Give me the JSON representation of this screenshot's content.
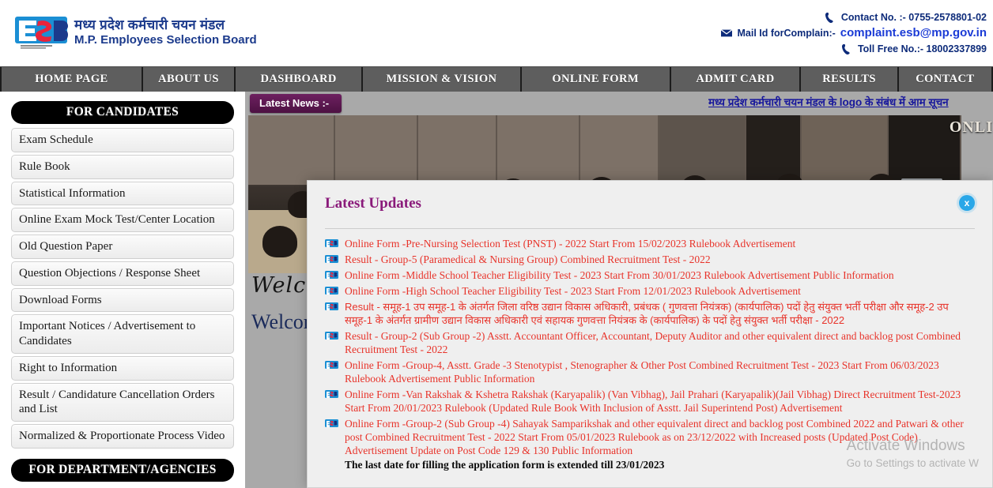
{
  "header": {
    "logo": {
      "abbr": "ESB",
      "hindi_title": "मध्य प्रदेश कर्मचारी चयन मंडल",
      "english_title": "M.P. Employees Selection Board"
    },
    "contact": {
      "phone_icon": "phone-icon",
      "phone_label": "Contact No. :- 0755-2578801-02",
      "mail_icon": "mail-icon",
      "mail_label": "Mail Id forComplain:-",
      "mail_value": "complaint.esb@mp.gov.in",
      "tollfree_icon": "phone-icon",
      "tollfree_label": "Toll Free No.:- 18002337899"
    }
  },
  "nav": {
    "items": [
      {
        "label": "HOME PAGE"
      },
      {
        "label": "ABOUT US"
      },
      {
        "label": "DASHBOARD"
      },
      {
        "label": "MISSION & VISION"
      },
      {
        "label": "ONLINE FORM"
      },
      {
        "label": "ADMIT CARD"
      },
      {
        "label": "RESULTS"
      },
      {
        "label": "CONTACT"
      }
    ]
  },
  "sidebar": {
    "candidates_title": "FOR CANDIDATES",
    "candidates_items": [
      {
        "label": "Exam Schedule"
      },
      {
        "label": "Rule Book"
      },
      {
        "label": "Statistical Information"
      },
      {
        "label": "Online Exam Mock Test/Center Location"
      },
      {
        "label": "Old Question Paper"
      },
      {
        "label": "Question Objections / Response Sheet"
      },
      {
        "label": "Download Forms"
      },
      {
        "label": "Important Notices / Advertisement to Candidates"
      },
      {
        "label": "Right to Information"
      },
      {
        "label": "Result / Candidature Cancellation Orders and List"
      },
      {
        "label": "Normalized & Proportionate Process Video"
      }
    ],
    "department_title": "FOR DEPARTMENT/AGENCIES"
  },
  "content": {
    "news_tag": "Latest News :-",
    "news_marquee": "मध्य प्रदेश कर्मचारी चयन मंडल के logo के संबंध में आम सूचन",
    "welcome_script": "Welco",
    "welcome_plain": "Welcom",
    "online_badge": "ONLI"
  },
  "modal": {
    "title": "Latest Updates",
    "close_icon": "close-icon",
    "close_label": "x",
    "bullet_icon": "esb-bullet-icon",
    "updates": [
      {
        "text": "Online Form -Pre-Nursing Selection Test (PNST) - 2022 Start From 15/02/2023      Rulebook   Advertisement",
        "script": "latin"
      },
      {
        "text": "Result - Group-5 (Paramedical & Nursing Group) Combined Recruitment Test - 2022",
        "script": "latin"
      },
      {
        "text": "Online Form -Middle School Teacher Eligibility Test - 2023 Start From 30/01/2023      Rulebook    Advertisement      Public Information",
        "script": "latin"
      },
      {
        "text": "Online Form -High School Teacher Eligibility Test - 2023 Start From 12/01/2023      Rulebook     Advertisement",
        "script": "latin"
      },
      {
        "text": "Result - समूह-1 उप समूह-1 के अंतर्गत जिला वरिष्ठ उद्यान विकास अधिकारी, प्रबंधक ( गुणवत्ता नियंत्रक) (कार्यपालिक) पदों हेतु संयुक्त भर्ती परीक्षा और समूह-2 उप समूह-1 के अंतर्गत ग्रामीण उद्यान विकास अधिकारी एवं सहायक गुणवत्ता नियंत्रक के (कार्यपालिक) के पदों हेतु संयुक्त भर्ती परीक्षा - 2022",
        "script": "devanagari"
      },
      {
        "text": "Result - Group-2 (Sub Group -2) Asstt. Accountant Officer, Accountant, Deputy Auditor and other equivalent direct and backlog post Combined Recruitment Test - 2022",
        "script": "latin"
      },
      {
        "text": "Online Form -Group-4, Asstt. Grade -3 Stenotypist , Stenographer & Other Post Combined Recruitment Test - 2023 Start From 06/03/2023      Rulebook      Advertisement      Public Information",
        "script": "latin"
      },
      {
        "text": "Online Form -Van Rakshak & Kshetra Rakshak (Karyapalik) (Van Vibhag), Jail Prahari (Karyapalik)(Jail Vibhag) Direct Recruitment Test-2023 Start From 20/01/2023      Rulebook (Updated Rule Book With Inclusion of Asstt. Jail Superintend Post) Advertisement",
        "script": "latin"
      },
      {
        "text": "Online Form -Group-2 (Sub Group -4) Sahayak Samparikshak and other equivalent direct and backlog post Combined 2022 and Patwari & other post Combined Recruitment Test - 2022 Start From 05/01/2023      Rulebook as on 23/12/2022 with Increased posts (Updated Post Code)   Advertisement      Update on Post Code 129 & 130      Public Information",
        "script": "latin",
        "note": "The last date for filling the application form is extended till 23/01/2023"
      }
    ]
  },
  "watermark": {
    "line1": "Activate Windows",
    "line2": "Go to Settings to activate W"
  },
  "colors": {
    "nav_bg": "#5e5e5e",
    "accent_purple": "#8a1a7a",
    "link_red": "#e8332a",
    "brand_blue": "#1b3a8c",
    "close_blue": "#29a7e8"
  }
}
